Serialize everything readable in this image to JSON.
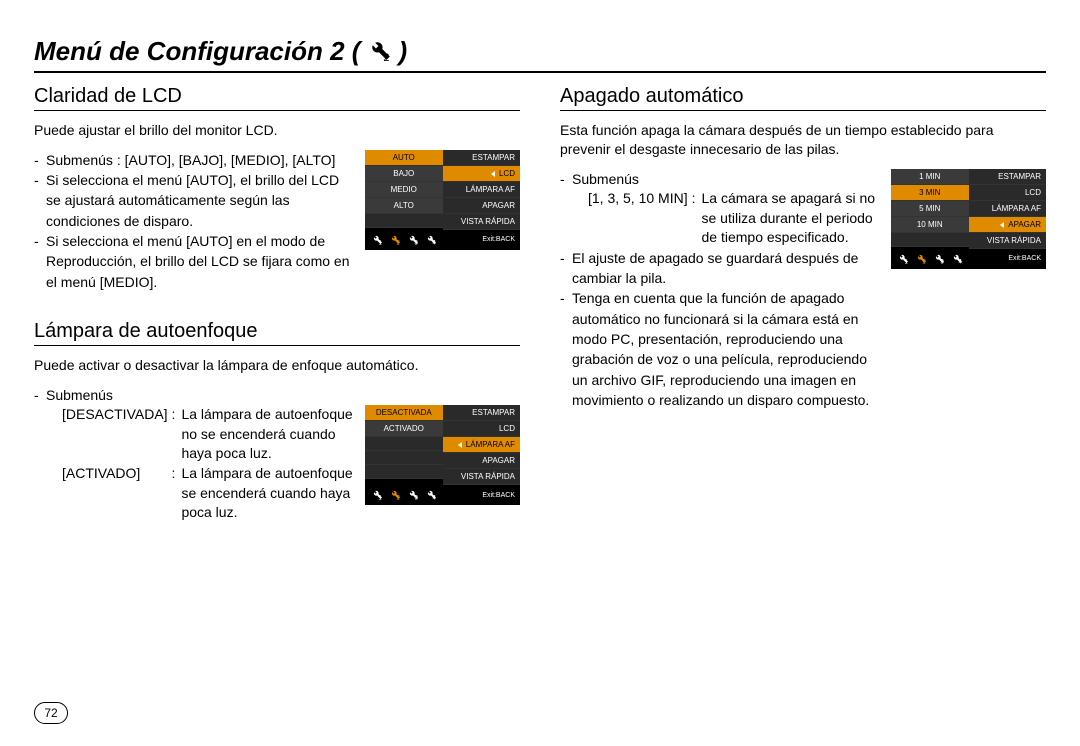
{
  "page_title": "Menú de Configuración 2 (",
  "page_title_close": ")",
  "page_number": "72",
  "left": {
    "sec1": {
      "heading": "Claridad de LCD",
      "intro": "Puede ajustar el brillo del monitor LCD.",
      "b1": "Submenús : [AUTO], [BAJO], [MEDIO], [ALTO]",
      "b2": "Si selecciona el menú [AUTO], el brillo del LCD se ajustará automáticamente según las condiciones de disparo.",
      "b3": "Si selecciona el menú [AUTO] en el modo de Reproducción, el brillo del LCD se fijara como en el menú [MEDIO].",
      "menu_left": [
        "AUTO",
        "BAJO",
        "MEDIO",
        "ALTO"
      ],
      "menu_right": [
        "ESTAMPAR",
        "LCD",
        "LÁMPARA  AF",
        "APAGAR",
        "VISTA RÁPIDA"
      ],
      "left_sel_idx": 0,
      "right_hl_idx": 1,
      "exit": "Exit:BACK"
    },
    "sec2": {
      "heading": "Lámpara de autoenfoque",
      "intro": "Puede activar o desactivar la lámpara de enfoque automático.",
      "sub_label": "Submenús",
      "defs": [
        {
          "k": "[DESACTIVADA]",
          "v": "La lámpara de autoenfoque no se encenderá cuando haya poca luz."
        },
        {
          "k": "[ACTIVADO]",
          "v": "La lámpara de autoenfoque se encenderá cuando haya poca luz."
        }
      ],
      "menu_left": [
        "DESACTIVADA",
        "ACTIVADO"
      ],
      "menu_right": [
        "ESTAMPAR",
        "LCD",
        "LÁMPARA  AF",
        "APAGAR",
        "VISTA RÁPIDA"
      ],
      "left_sel_idx": 0,
      "right_hl_idx": 2,
      "exit": "Exit:BACK"
    }
  },
  "right": {
    "sec1": {
      "heading": "Apagado automático",
      "intro": "Esta función apaga la cámara después de un tiempo establecido para prevenir el desgaste innecesario de las pilas.",
      "sub_label": "Submenús",
      "def_k": "[1, 3, 5, 10 MIN]",
      "def_v": "La cámara se apagará si no se utiliza durante el periodo de tiempo especificado.",
      "b2": "El ajuste de apagado se guardará después de cambiar la pila.",
      "b3": "Tenga en cuenta que la función de apagado automático no funcionará si la cámara está en modo PC, presentación, reproduciendo una grabación de voz o una película, reproduciendo un archivo GIF, reproduciendo una imagen en movimiento o realizando un disparo compuesto.",
      "menu_left": [
        "1 MIN",
        "3 MIN",
        "5 MIN",
        "10 MIN"
      ],
      "menu_right": [
        "ESTAMPAR",
        "LCD",
        "LÁMPARA  AF",
        "APAGAR",
        "VISTA RÁPIDA"
      ],
      "left_sel_idx": 1,
      "right_hl_idx": 3,
      "exit": "Exit:BACK"
    }
  }
}
